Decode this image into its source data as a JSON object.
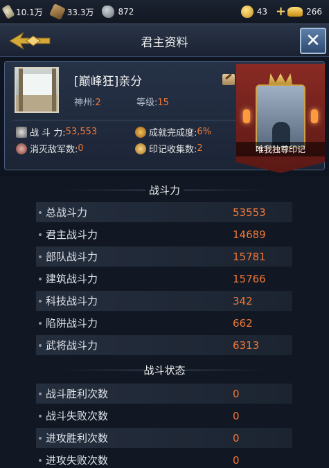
{
  "resources": {
    "food": "10.1万",
    "wood": "33.3万",
    "stone": "872",
    "coins": "43",
    "gold": "266"
  },
  "header": {
    "title": "君主资料"
  },
  "profile": {
    "name": "[巅峰狂]亲分",
    "region_label": "神州:",
    "region_value": "2",
    "level_label": "等级:",
    "level_value": "15",
    "power_label": "战  斗  力:",
    "power_value": "53,553",
    "achievement_label": "成就完成度:",
    "achievement_value": "6%",
    "kills_label": "消灭敌军数:",
    "kills_value": "0",
    "seals_label": "印记收集数:",
    "seals_value": "2",
    "emblem_label": "唯我独尊印记"
  },
  "combat_power": {
    "title": "战斗力",
    "rows": [
      {
        "label": "总战斗力",
        "value": "53553"
      },
      {
        "label": "君主战斗力",
        "value": "14689"
      },
      {
        "label": "部队战斗力",
        "value": "15781"
      },
      {
        "label": "建筑战斗力",
        "value": "15766"
      },
      {
        "label": "科技战斗力",
        "value": "342"
      },
      {
        "label": "陷阱战斗力",
        "value": "662"
      },
      {
        "label": "武将战斗力",
        "value": "6313"
      }
    ]
  },
  "battle_status": {
    "title": "战斗状态",
    "rows": [
      {
        "label": "战斗胜利次数",
        "value": "0"
      },
      {
        "label": "战斗失败次数",
        "value": "0"
      },
      {
        "label": "进攻胜利次数",
        "value": "0"
      },
      {
        "label": "进攻失败次数",
        "value": "0"
      }
    ]
  }
}
